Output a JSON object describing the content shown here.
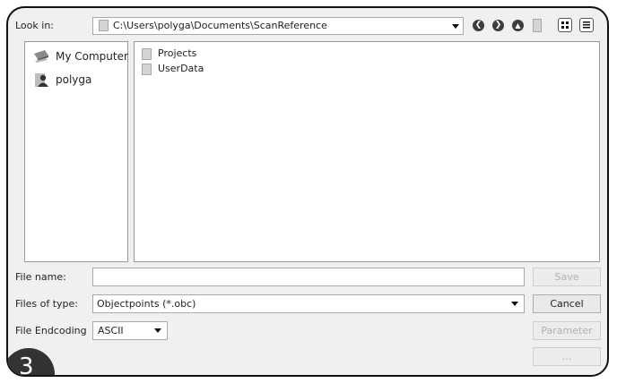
{
  "dialog": {
    "look_in_label": "Look in:",
    "path": "C:\\Users\\polyga\\Documents\\ScanReference",
    "nav": {
      "back_glyph": "❮",
      "forward_glyph": "❯",
      "up_glyph": "▲"
    }
  },
  "sidebar": {
    "items": [
      {
        "label": "My Computer",
        "icon": "computer-icon"
      },
      {
        "label": "polyga",
        "icon": "user-icon"
      }
    ]
  },
  "files": [
    {
      "name": "Projects",
      "icon": "folder-icon"
    },
    {
      "name": "UserData",
      "icon": "folder-icon"
    }
  ],
  "form": {
    "file_name_label": "File name:",
    "file_name_value": "",
    "files_of_type_label": "Files of type:",
    "files_of_type_value": "Objectpoints (*.obc)",
    "encoding_label": "File Endcoding",
    "encoding_value": "ASCII"
  },
  "buttons": {
    "save": "Save",
    "cancel": "Cancel",
    "parameter": "Parameter",
    "more": "..."
  },
  "badge": {
    "step": "3"
  }
}
